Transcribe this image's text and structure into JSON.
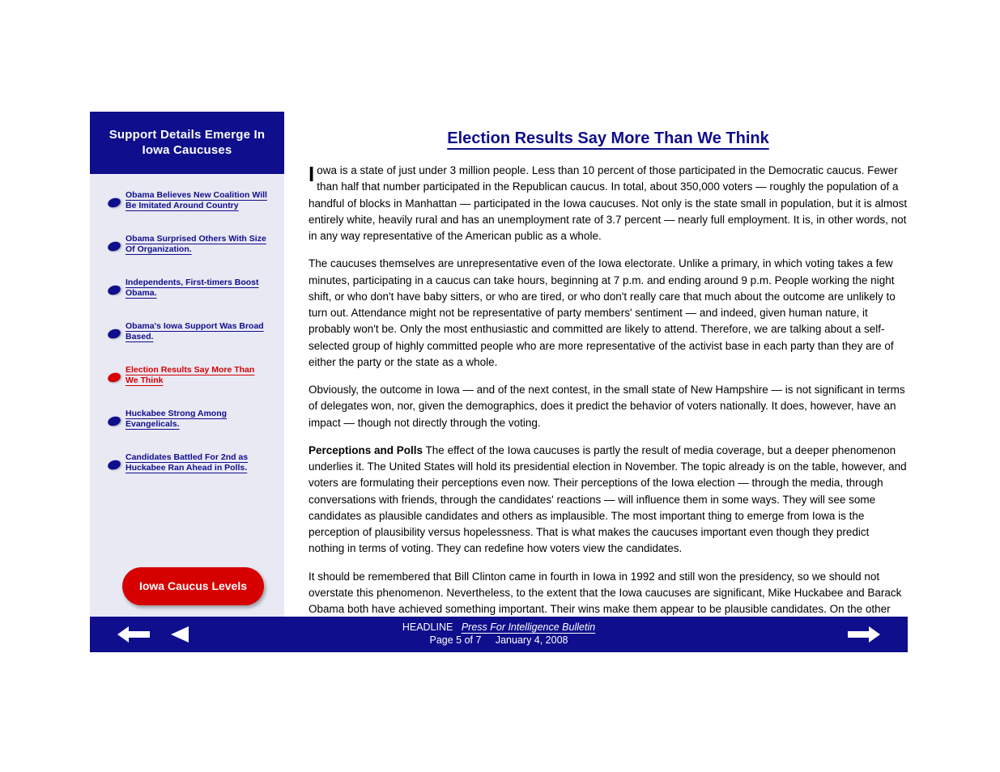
{
  "sidebar": {
    "title": "Support Details Emerge In Iowa Caucuses",
    "items": [
      {
        "label": "Obama Believes New Coalition Will Be Imitated Around Country",
        "color": "blue"
      },
      {
        "label": "Obama Surprised Others With Size Of Organization.",
        "color": "blue"
      },
      {
        "label": "Independents, First-timers Boost Obama.",
        "color": "blue"
      },
      {
        "label": "Obama's Iowa Support Was Broad Based.",
        "color": "blue"
      },
      {
        "label": "Election Results Say More Than We Think",
        "color": "red"
      },
      {
        "label": "Huckabee Strong Among Evangelicals.",
        "color": "blue"
      },
      {
        "label": "Candidates Battled For 2nd as Huckabee Ran Ahead in Polls.",
        "color": "blue"
      }
    ],
    "button": "Iowa Caucus Levels"
  },
  "main": {
    "title": "Election Results Say More Than We Think",
    "paragraphs": [
      "Iowa is a state of just under 3 million people. Less than 10 percent of those participated in the Democratic caucus. Fewer than half that number participated in the Republican caucus. In total, about 350,000 voters — roughly the population of a handful of blocks in Manhattan — participated in the Iowa caucuses. Not only is the state small in population, but it is almost entirely white, heavily rural and has an unemployment rate of 3.7 percent — nearly full employment. It is, in other words, not in any way representative of the American public as a whole.",
      "The caucuses themselves are unrepresentative even of the Iowa electorate. Unlike a primary, in which voting takes a few minutes, participating in a caucus can take hours, beginning at 7 p.m. and ending around 9 p.m. People working the night shift, or who don't have baby sitters, or who are tired, or who don't really care that much about the outcome are unlikely to turn out. Attendance might not be representative of party members' sentiment — and indeed, given human nature, it probably won't be. Only the most enthusiastic and committed are likely to attend. Therefore, we are talking about a self-selected group of highly committed people who are more representative of the activist base in each party than they are of either the party or the state as a whole.",
      "Obviously, the outcome in Iowa — and of the next contest, in the small state of New Hampshire — is not significant in terms of delegates won, nor, given the demographics, does it predict the behavior of voters nationally. It does, however, have an impact — though not directly through the voting.",
      "<strong>Perceptions and Polls</strong>  The effect of the Iowa caucuses is partly the result of media coverage, but a deeper phenomenon underlies it. The United States will hold its presidential election in November. The topic already is on the table, however, and voters are formulating their perceptions even now. Their perceptions of the Iowa election — through the media, through conversations with friends, through the candidates' reactions — will influence them in some ways. They will see some candidates as plausible candidates and others as implausible. The most important thing to emerge from Iowa is the perception of plausibility versus hopelessness. That is what makes the caucuses important even though they predict nothing in terms of voting. They can redefine how voters view the candidates.",
      "It should be remembered that Bill Clinton came in fourth in Iowa in 1992 and still won the presidency, so we should not overstate this phenomenon. Nevertheless, to the extent that the Iowa caucuses are significant, Mike Huckabee and Barack Obama both have achieved something important. Their wins make them appear to be plausible candidates. On the other side, Hillary Clinton and Mitt Romney have not been eliminated but have been hurt by the perception that voters have rejected them. Given the"
    ]
  },
  "footer": {
    "headline_label": "HEADLINE",
    "headline_link": "Press For Intelligence Bulletin",
    "page_marker": "Page 5 of 7",
    "date": "January 4, 2008"
  }
}
